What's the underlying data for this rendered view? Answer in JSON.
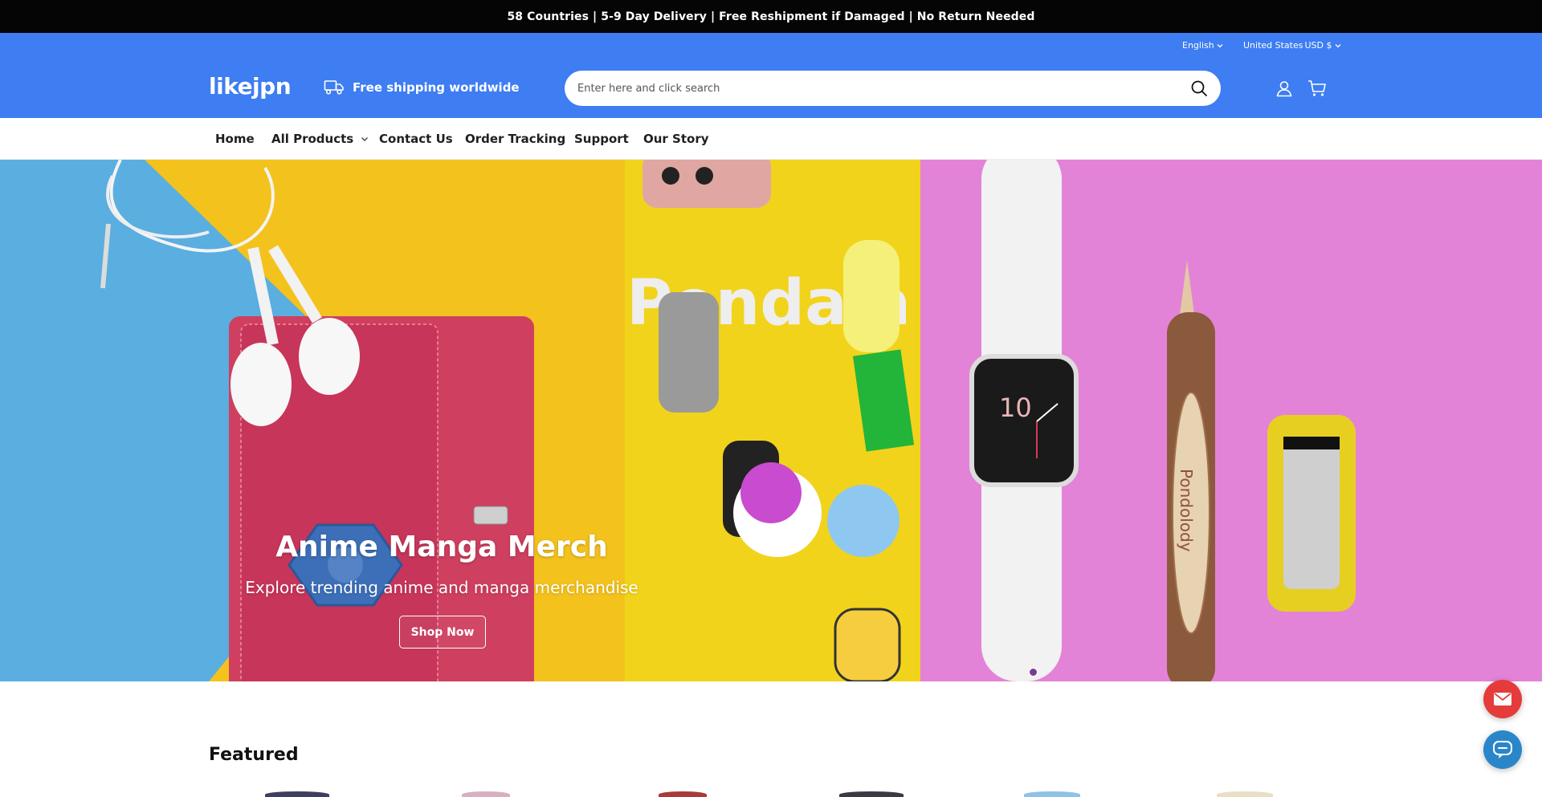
{
  "announcement": "58 Countries | 5-9 Day Delivery | Free Reshipment if Damaged | No Return Needed",
  "header": {
    "language": "English",
    "currency": "United States",
    "currency_code": "USD $",
    "logo": "likejpn",
    "shipping_text": "Free shipping worldwide",
    "search_placeholder": "Enter here and click search",
    "icons": [
      "truck-icon",
      "search-icon",
      "account-icon",
      "cart-icon"
    ]
  },
  "nav": {
    "items": [
      "Home",
      "All Products",
      "Contact Us",
      "Order Tracking",
      "Support",
      "Our Story"
    ]
  },
  "hero": {
    "title": "Anime Manga Merch",
    "subtitle": "Explore trending anime and manga merchandise",
    "button": "Shop Now",
    "slide_count": 1
  },
  "featured": {
    "heading": "Featured"
  },
  "colors": {
    "brand_blue": "#3e7df2",
    "announcement_bg": "#050505",
    "mail_fab": "#e53b3b",
    "chat_fab": "#2a86c9"
  },
  "floating": {
    "mail": "mail-icon",
    "chat": "chat-icon"
  }
}
